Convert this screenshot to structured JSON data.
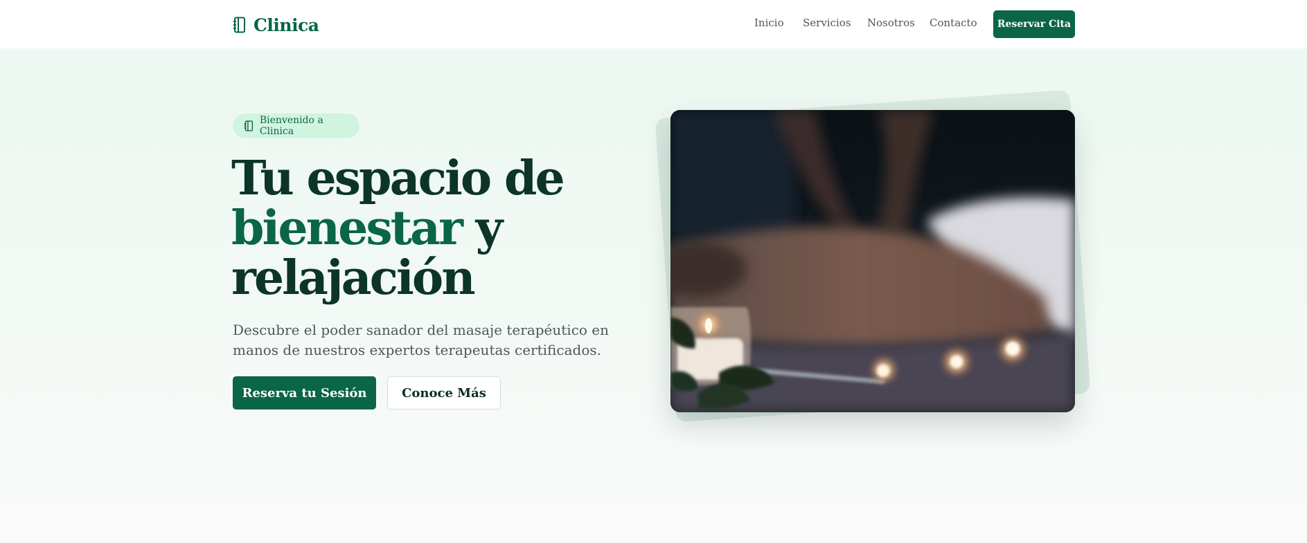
{
  "header": {
    "brand": "Clinica",
    "brand_icon": "notebook-icon",
    "nav": [
      "Inicio",
      "Servicios",
      "Nosotros",
      "Contacto"
    ],
    "cta_label": "Reservar Cita"
  },
  "hero": {
    "badge_text": "Bienvenido a Clinica",
    "badge_icon": "notebook-icon",
    "title_line1": "Tu espacio de",
    "title_accent": "bienestar",
    "title_line2_rest": " y",
    "title_line3": "relajación",
    "subtitle": "Descubre el poder sanador del masaje terapéutico en manos de nuestros expertos terapeutas certificados.",
    "primary_cta": "Reserva tu Sesión",
    "secondary_cta": "Conoce Más"
  },
  "colors": {
    "brand": "#0b6548",
    "title": "#0c3528",
    "badge_bg": "#d1f4e1",
    "hero_bg": "#ecf8f1"
  }
}
